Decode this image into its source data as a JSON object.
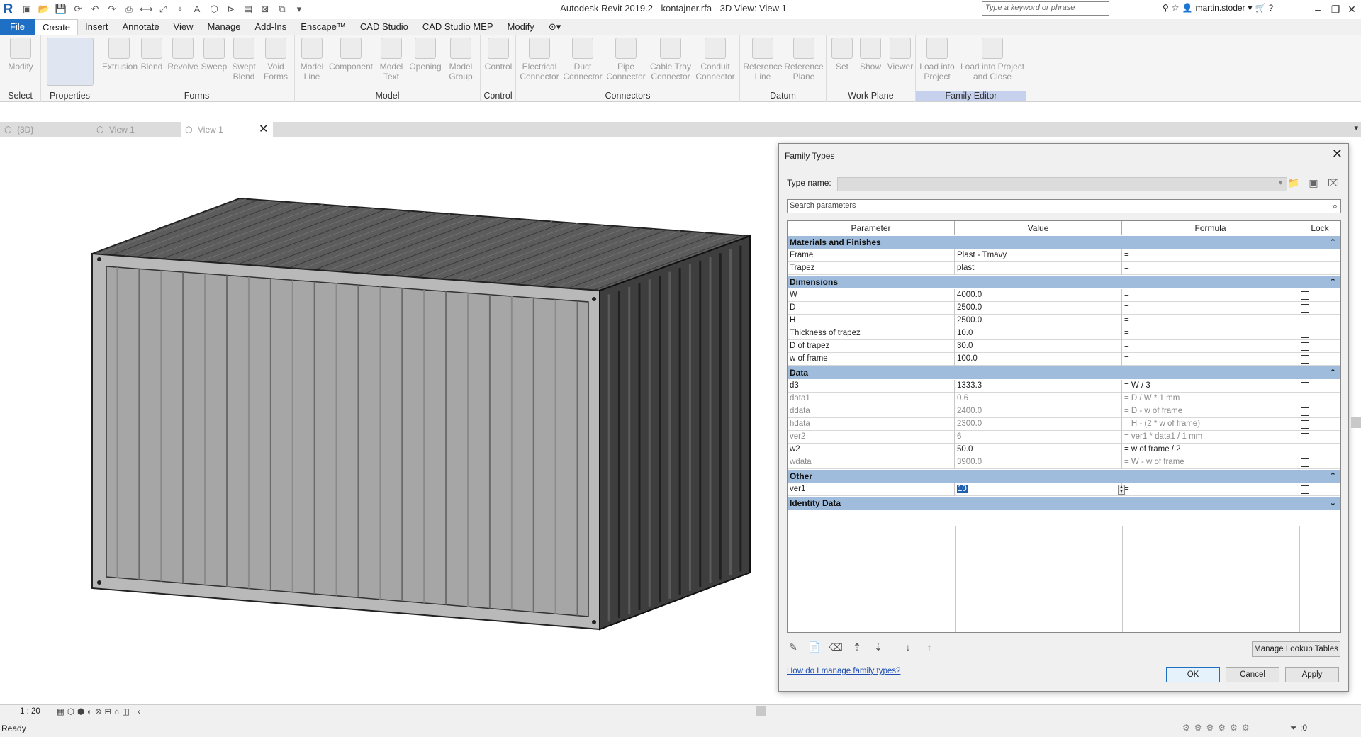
{
  "titlebar": {
    "title": "Autodesk Revit 2019.2 - kontajner.rfa - 3D View: View 1",
    "search_placeholder": "Type a keyword or phrase",
    "user": "martin.stoder"
  },
  "menu": {
    "tabs": [
      "File",
      "Create",
      "Insert",
      "Annotate",
      "View",
      "Manage",
      "Add-Ins",
      "Enscape™",
      "CAD Studio",
      "CAD Studio MEP",
      "Modify"
    ]
  },
  "ribbon": {
    "groups": {
      "select": "Select",
      "properties": "Properties",
      "forms": "Forms",
      "model": "Model",
      "control": "Control",
      "connectors": "Connectors",
      "datum": "Datum",
      "work_plane": "Work Plane",
      "family_editor": "Family Editor"
    },
    "buttons": {
      "modify": "Modify",
      "extrusion": "Extrusion",
      "blend": "Blend",
      "revolve": "Revolve",
      "sweep": "Sweep",
      "swept_blend": "Swept Blend",
      "void_forms": "Void Forms",
      "model_line": "Model Line",
      "component": "Component",
      "model_text": "Model Text",
      "opening": "Opening",
      "model_group": "Model Group",
      "control": "Control",
      "electrical_connector": "Electrical Connector",
      "duct_connector": "Duct Connector",
      "pipe_connector": "Pipe Connector",
      "cable_tray_connector": "Cable Tray Connector",
      "conduit_connector": "Conduit Connector",
      "reference_line": "Reference Line",
      "reference_plane": "Reference Plane",
      "set": "Set",
      "show": "Show",
      "viewer": "Viewer",
      "load_into_project": "Load into Project",
      "load_into_project_close": "Load into Project and Close"
    }
  },
  "viewtabs": [
    "{3D}",
    "View 1",
    "View 1"
  ],
  "dialog": {
    "title": "Family Types",
    "type_name_label": "Type name:",
    "search_placeholder": "Search parameters",
    "columns": [
      "Parameter",
      "Value",
      "Formula",
      "Lock"
    ],
    "groups": [
      {
        "name": "Materials and Finishes",
        "rows": [
          {
            "param": "Frame",
            "value": "Plast - Tmavy",
            "formula": "=",
            "lock": false,
            "grey": false,
            "lockbox": false
          },
          {
            "param": "Trapez",
            "value": "plast",
            "formula": "=",
            "lock": false,
            "grey": false,
            "lockbox": false
          }
        ]
      },
      {
        "name": "Dimensions",
        "rows": [
          {
            "param": "W",
            "value": "4000.0",
            "formula": "=",
            "lock": false,
            "grey": false,
            "lockbox": true
          },
          {
            "param": "D",
            "value": "2500.0",
            "formula": "=",
            "lock": false,
            "grey": false,
            "lockbox": true
          },
          {
            "param": "H",
            "value": "2500.0",
            "formula": "=",
            "lock": false,
            "grey": false,
            "lockbox": true
          },
          {
            "param": "Thickness of trapez",
            "value": "10.0",
            "formula": "=",
            "lock": false,
            "grey": false,
            "lockbox": true
          },
          {
            "param": "D of trapez",
            "value": "30.0",
            "formula": "=",
            "lock": false,
            "grey": false,
            "lockbox": true
          },
          {
            "param": "w of frame",
            "value": "100.0",
            "formula": "=",
            "lock": false,
            "grey": false,
            "lockbox": true
          }
        ]
      },
      {
        "name": "Data",
        "rows": [
          {
            "param": "d3",
            "value": "1333.3",
            "formula": "= W / 3",
            "lock": false,
            "grey": false,
            "lockbox": true
          },
          {
            "param": "data1",
            "value": "0.6",
            "formula": "= D / W * 1 mm",
            "lock": false,
            "grey": true,
            "lockbox": true
          },
          {
            "param": "ddata",
            "value": "2400.0",
            "formula": "= D - w of frame",
            "lock": false,
            "grey": true,
            "lockbox": true
          },
          {
            "param": "hdata",
            "value": "2300.0",
            "formula": "= H - (2 * w of frame)",
            "lock": false,
            "grey": true,
            "lockbox": true
          },
          {
            "param": "ver2",
            "value": "6",
            "formula": "= ver1 * data1 / 1 mm",
            "lock": false,
            "grey": true,
            "lockbox": true
          },
          {
            "param": "w2",
            "value": "50.0",
            "formula": "= w of frame / 2",
            "lock": false,
            "grey": false,
            "lockbox": true
          },
          {
            "param": "wdata",
            "value": "3900.0",
            "formula": "= W - w of frame",
            "lock": false,
            "grey": true,
            "lockbox": true
          }
        ]
      },
      {
        "name": "Other",
        "rows": [
          {
            "param": "ver1",
            "value": "10",
            "formula": "=",
            "lock": false,
            "grey": false,
            "lockbox": true,
            "editing": true
          }
        ]
      },
      {
        "name": "Identity Data",
        "rows": []
      }
    ],
    "manage_lookup": "Manage Lookup Tables",
    "help_link": "How do I manage family types?",
    "ok": "OK",
    "cancel": "Cancel",
    "apply": "Apply"
  },
  "viewbar": {
    "scale": "1 : 20"
  },
  "status": {
    "text": "Ready",
    "filter_count": ":0"
  }
}
